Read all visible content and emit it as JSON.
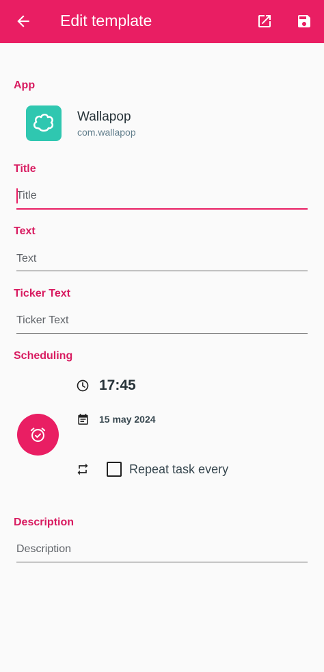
{
  "toolbar": {
    "title": "Edit template",
    "icons": {
      "back": "arrow-back-icon",
      "open": "open-in-new-icon",
      "save": "save-icon"
    }
  },
  "app": {
    "label": "App",
    "name": "Wallapop",
    "package": "com.wallapop",
    "icon": "wallapop-logo",
    "icon_color": "#2fc7b0"
  },
  "title_field": {
    "label": "Title",
    "placeholder": "Title",
    "value": ""
  },
  "text_field": {
    "label": "Text",
    "placeholder": "Text",
    "value": ""
  },
  "ticker_field": {
    "label": "Ticker Text",
    "placeholder": "Ticker Text",
    "value": ""
  },
  "scheduling": {
    "label": "Scheduling",
    "time": "17:45",
    "date": "15 may 2024",
    "repeat_label": "Repeat task every",
    "repeat_checked": false
  },
  "description_field": {
    "label": "Description",
    "placeholder": "Description",
    "value": ""
  },
  "colors": {
    "accent": "#e91e63",
    "label": "#d81b60",
    "background": "#fafafa"
  }
}
